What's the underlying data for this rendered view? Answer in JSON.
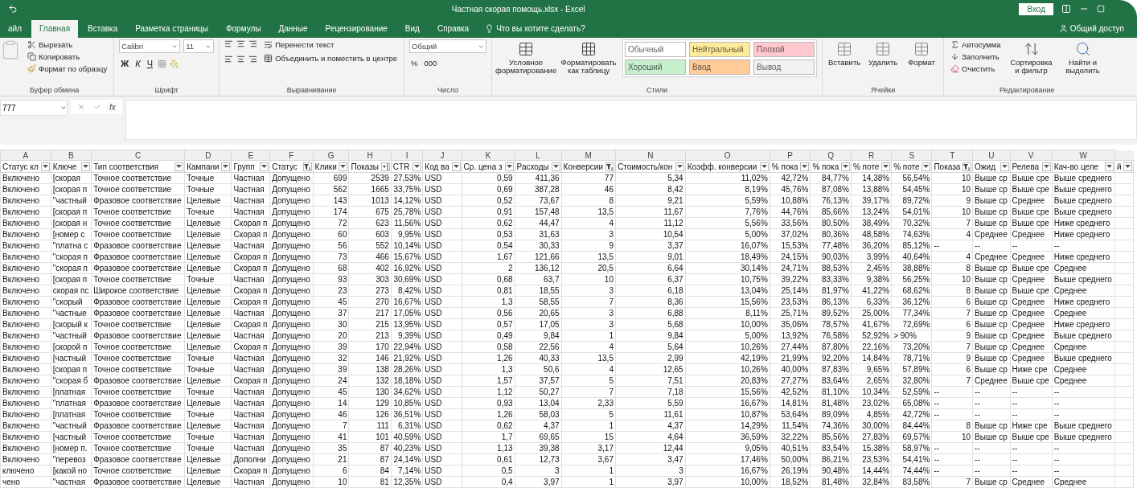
{
  "window": {
    "title": "Частная скорая помощь.xlsx  -  Excel",
    "sign_in": "Вход",
    "share": "Общий доступ"
  },
  "tabs": [
    {
      "label": "айл",
      "selected": false
    },
    {
      "label": "Главная",
      "selected": true
    },
    {
      "label": "Вставка",
      "selected": false
    },
    {
      "label": "Разметка страницы",
      "selected": false
    },
    {
      "label": "Формулы",
      "selected": false
    },
    {
      "label": "Данные",
      "selected": false
    },
    {
      "label": "Рецензирование",
      "selected": false
    },
    {
      "label": "Вид",
      "selected": false
    },
    {
      "label": "Справка",
      "selected": false
    }
  ],
  "tell_me": "Что вы хотите сделать?",
  "ribbon": {
    "clipboard": {
      "title": "Буфер обмена",
      "buttons": [
        "Вырезать",
        "Копировать",
        "Формат по образцу"
      ]
    },
    "font": {
      "title": "Шрифт",
      "font_name": "Calibri",
      "font_size": "11",
      "style_buttons": [
        "Ж",
        "К",
        "Ч"
      ]
    },
    "alignment": {
      "title": "Выравнивание",
      "wrap": "Перенести текст",
      "merge": "Объединить и поместить в центре"
    },
    "number": {
      "title": "Число",
      "format": "Общий",
      "percent": "%",
      "thousands": "000"
    },
    "styles": {
      "title": "Стили",
      "conditional": "Условное форматирование",
      "as_table": "Форматировать как таблицу",
      "cells": [
        {
          "label": "Обычный",
          "color": "#ffffff"
        },
        {
          "label": "Нейтральный",
          "color": "#ffeb9c"
        },
        {
          "label": "Плохой",
          "color": "#ffc7ce"
        },
        {
          "label": "Хороший",
          "color": "#c6efce"
        },
        {
          "label": "Ввод",
          "color": "#ffcc99"
        },
        {
          "label": "Вывод",
          "color": "#f2f2f2"
        }
      ]
    },
    "cells": {
      "title": "Ячейки",
      "buttons": [
        "Вставить",
        "Удалить",
        "Формат"
      ]
    },
    "editing": {
      "title": "Редактирование",
      "small": [
        "Автосумма",
        "Заполнить",
        "Очистить"
      ],
      "large": [
        "Сортировка и фильтр",
        "Найти и выделить"
      ]
    }
  },
  "formula_bar": {
    "name_box": "777",
    "function_label": "fx"
  },
  "sheet": {
    "columns": [
      {
        "letter": "A",
        "header": "Статус кл",
        "filtered": false,
        "sorted": false
      },
      {
        "letter": "B",
        "header": "Ключе",
        "filtered": false,
        "sorted": false
      },
      {
        "letter": "C",
        "header": "Тип соответствия",
        "filtered": false,
        "sorted": false
      },
      {
        "letter": "D",
        "header": "Кампани",
        "filtered": false,
        "sorted": false
      },
      {
        "letter": "E",
        "header": "Групп",
        "filtered": false,
        "sorted": false
      },
      {
        "letter": "F",
        "header": "Статус",
        "filtered": true,
        "sorted": false
      },
      {
        "letter": "G",
        "header": "Клики",
        "filtered": false,
        "sorted": false
      },
      {
        "letter": "H",
        "header": "Показы",
        "filtered": false,
        "sorted": true
      },
      {
        "letter": "I",
        "header": "CTR",
        "filtered": false,
        "sorted": false
      },
      {
        "letter": "J",
        "header": "Код ва",
        "filtered": false,
        "sorted": false
      },
      {
        "letter": "K",
        "header": "Ср. цена з",
        "filtered": false,
        "sorted": false
      },
      {
        "letter": "L",
        "header": "Расходы",
        "filtered": false,
        "sorted": false
      },
      {
        "letter": "M",
        "header": "Конверсии",
        "filtered": true,
        "sorted": false
      },
      {
        "letter": "N",
        "header": "Стоимость/кон",
        "filtered": false,
        "sorted": false
      },
      {
        "letter": "O",
        "header": "Коэфф. конверсии",
        "filtered": false,
        "sorted": false
      },
      {
        "letter": "P",
        "header": "% пока",
        "filtered": false,
        "sorted": false
      },
      {
        "letter": "Q",
        "header": "% пока",
        "filtered": false,
        "sorted": false
      },
      {
        "letter": "R",
        "header": "% поте",
        "filtered": false,
        "sorted": false
      },
      {
        "letter": "S",
        "header": "% поте",
        "filtered": false,
        "sorted": false
      },
      {
        "letter": "T",
        "header": "Показа",
        "filtered": true,
        "sorted": false
      },
      {
        "letter": "U",
        "header": "Ожид",
        "filtered": false,
        "sorted": false
      },
      {
        "letter": "V",
        "header": "Релева",
        "filtered": false,
        "sorted": false
      },
      {
        "letter": "W",
        "header": "Кач-во целе",
        "filtered": false,
        "sorted": false
      },
      {
        "header": "й",
        "filtered": false,
        "sorted": false
      }
    ],
    "rows": [
      [
        "Включено",
        "[скорая",
        "Точное соответствие",
        "Точные",
        "Частная",
        "Допущено",
        "699",
        "2539",
        "27,53%",
        "USD",
        "0,59",
        "411,36",
        "77",
        "5,34",
        "11,02%",
        "42,72%",
        "84,77%",
        "14,38%",
        "56,54%",
        "10",
        "Выше ср",
        "Выше сре",
        "Выше среднего"
      ],
      [
        "Включено",
        "[скорая п",
        "Точное соответствие",
        "Точные",
        "Частная",
        "Допущено",
        "562",
        "1665",
        "33,75%",
        "USD",
        "0,69",
        "387,28",
        "46",
        "8,42",
        "8,19%",
        "45,76%",
        "87,08%",
        "13,88%",
        "54,45%",
        "10",
        "Выше ср",
        "Выше сре",
        "Выше среднего"
      ],
      [
        "Включено",
        "\"частный",
        "Фразовое соответствие",
        "Целевые",
        "Частная",
        "Допущено",
        "143",
        "1013",
        "14,12%",
        "USD",
        "0,52",
        "73,67",
        "8",
        "9,21",
        "5,59%",
        "10,88%",
        "76,13%",
        "39,17%",
        "89,72%",
        "9",
        "Выше ср",
        "Среднее",
        "Выше среднего"
      ],
      [
        "Включено",
        "[скорая п",
        "Точное соответствие",
        "Точные",
        "Частная",
        "Допущено",
        "174",
        "675",
        "25,78%",
        "USD",
        "0,91",
        "157,48",
        "13,5",
        "11,67",
        "7,76%",
        "44,76%",
        "85,66%",
        "13,24%",
        "54,01%",
        "10",
        "Выше ср",
        "Выше сре",
        "Выше среднего"
      ],
      [
        "Включено",
        "[скорая н",
        "Точное соответствие",
        "Целевые",
        "Скорая п",
        "Допущено",
        "72",
        "623",
        "11,56%",
        "USD",
        "0,62",
        "44,47",
        "4",
        "11,12",
        "5,56%",
        "33,56%",
        "80,50%",
        "38,49%",
        "70,32%",
        "7",
        "Выше ср",
        "Выше сре",
        "Ниже среднего"
      ],
      [
        "Включено",
        "[номер с",
        "Точное соответствие",
        "Целевые",
        "Скорая п",
        "Допущено",
        "60",
        "603",
        "9,95%",
        "USD",
        "0,53",
        "31,63",
        "3",
        "10,54",
        "5,00%",
        "37,02%",
        "80,36%",
        "48,58%",
        "74,63%",
        "4",
        "Среднее",
        "Среднее",
        "Ниже среднего"
      ],
      [
        "Включено",
        "\"платна с",
        "Фразовое соответствие",
        "Целевые",
        "Частная",
        "Допущено",
        "56",
        "552",
        "10,14%",
        "USD",
        "0,54",
        "30,33",
        "9",
        "3,37",
        "16,07%",
        "15,53%",
        "77,48%",
        "36,20%",
        "85,12%",
        "--",
        "--",
        "--",
        "--"
      ],
      [
        "Включено",
        "\"скорая п",
        "Фразовое соответствие",
        "Целевые",
        "Скорая п",
        "Допущено",
        "73",
        "466",
        "15,67%",
        "USD",
        "1,67",
        "121,66",
        "13,5",
        "9,01",
        "18,49%",
        "24,15%",
        "90,03%",
        "3,99%",
        "40,64%",
        "4",
        "Среднее",
        "Среднее",
        "Ниже среднего"
      ],
      [
        "Включено",
        "\"скорая п",
        "Фразовое соответствие",
        "Целевые",
        "Скорая п",
        "Допущено",
        "68",
        "402",
        "16,92%",
        "USD",
        "2",
        "136,12",
        "20,5",
        "6,64",
        "30,14%",
        "24,71%",
        "88,53%",
        "2,45%",
        "38,88%",
        "8",
        "Выше ср",
        "Выше сре",
        "Среднее"
      ],
      [
        "Включено",
        "[скорая п",
        "Точное соответствие",
        "Точные",
        "Частная",
        "Допущено",
        "93",
        "303",
        "30,69%",
        "USD",
        "0,68",
        "63,7",
        "10",
        "6,37",
        "10,75%",
        "39,22%",
        "83,33%",
        "9,38%",
        "56,25%",
        "10",
        "Выше ср",
        "Среднее",
        "Выше среднего"
      ],
      [
        "Включено",
        "скорая пс",
        "Широкое соответствие",
        "Целевые",
        "Скорая п",
        "Допущено",
        "23",
        "273",
        "8,42%",
        "USD",
        "0,81",
        "18,55",
        "3",
        "6,18",
        "13,04%",
        "25,14%",
        "81,97%",
        "41,22%",
        "68,62%",
        "8",
        "Выше ср",
        "Выше сре",
        "Среднее"
      ],
      [
        "Включено",
        "\"скорый",
        "Фразовое соответствие",
        "Целевые",
        "Скорая п",
        "Допущено",
        "45",
        "270",
        "16,67%",
        "USD",
        "1,3",
        "58,55",
        "7",
        "8,36",
        "15,56%",
        "23,53%",
        "86,13%",
        "6,33%",
        "36,12%",
        "6",
        "Выше ср",
        "Среднее",
        "Ниже среднего"
      ],
      [
        "Включено",
        "\"частные",
        "Фразовое соответствие",
        "Целевые",
        "Частная",
        "Допущено",
        "37",
        "217",
        "17,05%",
        "USD",
        "0,56",
        "20,65",
        "3",
        "6,88",
        "8,11%",
        "25,71%",
        "89,52%",
        "25,00%",
        "77,34%",
        "7",
        "Выше ср",
        "Среднее",
        "Среднее"
      ],
      [
        "Включено",
        "[скорый к",
        "Точное соответствие",
        "Целевые",
        "Скорая п",
        "Допущено",
        "30",
        "215",
        "13,95%",
        "USD",
        "0,57",
        "17,05",
        "3",
        "5,68",
        "10,00%",
        "35,06%",
        "78,57%",
        "41,67%",
        "72,69%",
        "6",
        "Выше ср",
        "Среднее",
        "Ниже среднего"
      ],
      [
        "Включено",
        "\"частный",
        "Фразовое соответствие",
        "Целевые",
        "Частная",
        "Допущено",
        "20",
        "213",
        "9,39%",
        "USD",
        "0,49",
        "9,84",
        "1",
        "9,84",
        "5,00%",
        "13,92%",
        "76,58%",
        "52,92%",
        "> 90%",
        "9",
        "Выше ср",
        "Среднее",
        "Выше среднего"
      ],
      [
        "Включено",
        "[скорой п",
        "Точное соответствие",
        "Целевые",
        "Скорая п",
        "Допущено",
        "39",
        "170",
        "22,94%",
        "USD",
        "0,58",
        "22,56",
        "4",
        "5,64",
        "10,26%",
        "27,44%",
        "87,80%",
        "22,16%",
        "73,20%",
        "7",
        "Выше ср",
        "Среднее",
        "Среднее"
      ],
      [
        "Включено",
        "[частный",
        "Точное соответствие",
        "Точные",
        "Частная",
        "Допущено",
        "32",
        "146",
        "21,92%",
        "USD",
        "1,26",
        "40,33",
        "13,5",
        "2,99",
        "42,19%",
        "21,99%",
        "92,20%",
        "14,84%",
        "78,71%",
        "9",
        "Выше ср",
        "Среднее",
        "Выше среднего"
      ],
      [
        "Включено",
        "[скорая п",
        "Точное соответствие",
        "Точные",
        "Частная",
        "Допущено",
        "39",
        "138",
        "28,26%",
        "USD",
        "1,3",
        "50,6",
        "4",
        "12,65",
        "10,26%",
        "40,00%",
        "87,83%",
        "9,65%",
        "57,89%",
        "6",
        "Выше ср",
        "Ниже сре",
        "Среднее"
      ],
      [
        "Включено",
        "\"скорая б",
        "Фразовое соответствие",
        "Целевые",
        "Скорая п",
        "Допущено",
        "24",
        "132",
        "18,18%",
        "USD",
        "1,57",
        "37,57",
        "5",
        "7,51",
        "20,83%",
        "27,27%",
        "83,64%",
        "2,65%",
        "32,80%",
        "7",
        "Среднее",
        "Выше сре",
        "Среднее"
      ],
      [
        "Включено",
        "[платная",
        "Точное соответствие",
        "Точные",
        "Частная",
        "Допущено",
        "45",
        "130",
        "34,62%",
        "USD",
        "1,12",
        "50,27",
        "7",
        "7,18",
        "15,56%",
        "42,52%",
        "81,10%",
        "10,34%",
        "52,59%",
        "--",
        "--",
        "--",
        "--"
      ],
      [
        "Включено",
        "\"платная",
        "Фразовое соответствие",
        "Целевые",
        "Частная",
        "Допущено",
        "14",
        "129",
        "10,85%",
        "USD",
        "0,93",
        "13,04",
        "2,33",
        "5,59",
        "16,67%",
        "14,81%",
        "81,48%",
        "23,02%",
        "65,08%",
        "--",
        "--",
        "--",
        "--"
      ],
      [
        "Включено",
        "[платная",
        "Точное соответствие",
        "Точные",
        "Частная",
        "Допущено",
        "46",
        "126",
        "36,51%",
        "USD",
        "1,26",
        "58,03",
        "5",
        "11,61",
        "10,87%",
        "53,64%",
        "89,09%",
        "4,85%",
        "42,72%",
        "--",
        "--",
        "--",
        "--"
      ],
      [
        "Включено",
        "\"частный",
        "Фразовое соответствие",
        "Целевые",
        "Частная",
        "Допущено",
        "7",
        "111",
        "6,31%",
        "USD",
        "0,62",
        "4,37",
        "1",
        "4,37",
        "14,29%",
        "11,54%",
        "74,36%",
        "30,00%",
        "84,44%",
        "8",
        "Выше ср",
        "Ниже сре",
        "Выше среднего"
      ],
      [
        "Включено",
        "[частный",
        "Точное соответствие",
        "Точные",
        "Частная",
        "Допущено",
        "41",
        "101",
        "40,59%",
        "USD",
        "1,7",
        "69,65",
        "15",
        "4,64",
        "36,59%",
        "32,22%",
        "85,56%",
        "27,83%",
        "69,57%",
        "10",
        "Выше ср",
        "Выше сре",
        "Выше среднего"
      ],
      [
        "Включено",
        "[номер п.",
        "Точное соответствие",
        "Точные",
        "Частная",
        "Допущено",
        "35",
        "87",
        "40,23%",
        "USD",
        "1,13",
        "39,38",
        "3,17",
        "12,44",
        "9,05%",
        "40,51%",
        "83,54%",
        "15,38%",
        "58,97%",
        "--",
        "--",
        "--",
        "--"
      ],
      [
        "Включено",
        "\"перевоз",
        "Фразовое соответствие",
        "Целевые",
        "Дополни",
        "Допущено",
        "21",
        "87",
        "24,14%",
        "USD",
        "0,61",
        "12,73",
        "3,67",
        "3,47",
        "17,46%",
        "50,00%",
        "86,21%",
        "23,53%",
        "54,41%",
        "--",
        "--",
        "--",
        "--"
      ],
      [
        "ключено",
        "[какой но",
        "Точное соответствие",
        "Целевые",
        "Скорая п",
        "Допущено",
        "6",
        "84",
        "7,14%",
        "USD",
        "0,5",
        "3",
        "1",
        "3",
        "16,67%",
        "26,19%",
        "90,48%",
        "14,44%",
        "74,44%",
        "--",
        "--",
        "--",
        "--"
      ],
      [
        "чено",
        "\"частная",
        "Фразовое соответствие",
        "Целевые",
        "Частная",
        "Допущено",
        "10",
        "81",
        "12,35%",
        "USD",
        "0,4",
        "3,97",
        "1",
        "3,97",
        "10,00%",
        "18,52%",
        "81,48%",
        "32,84%",
        "83,58%",
        "7",
        "Выше ср",
        "Среднее",
        "Среднее"
      ]
    ]
  }
}
